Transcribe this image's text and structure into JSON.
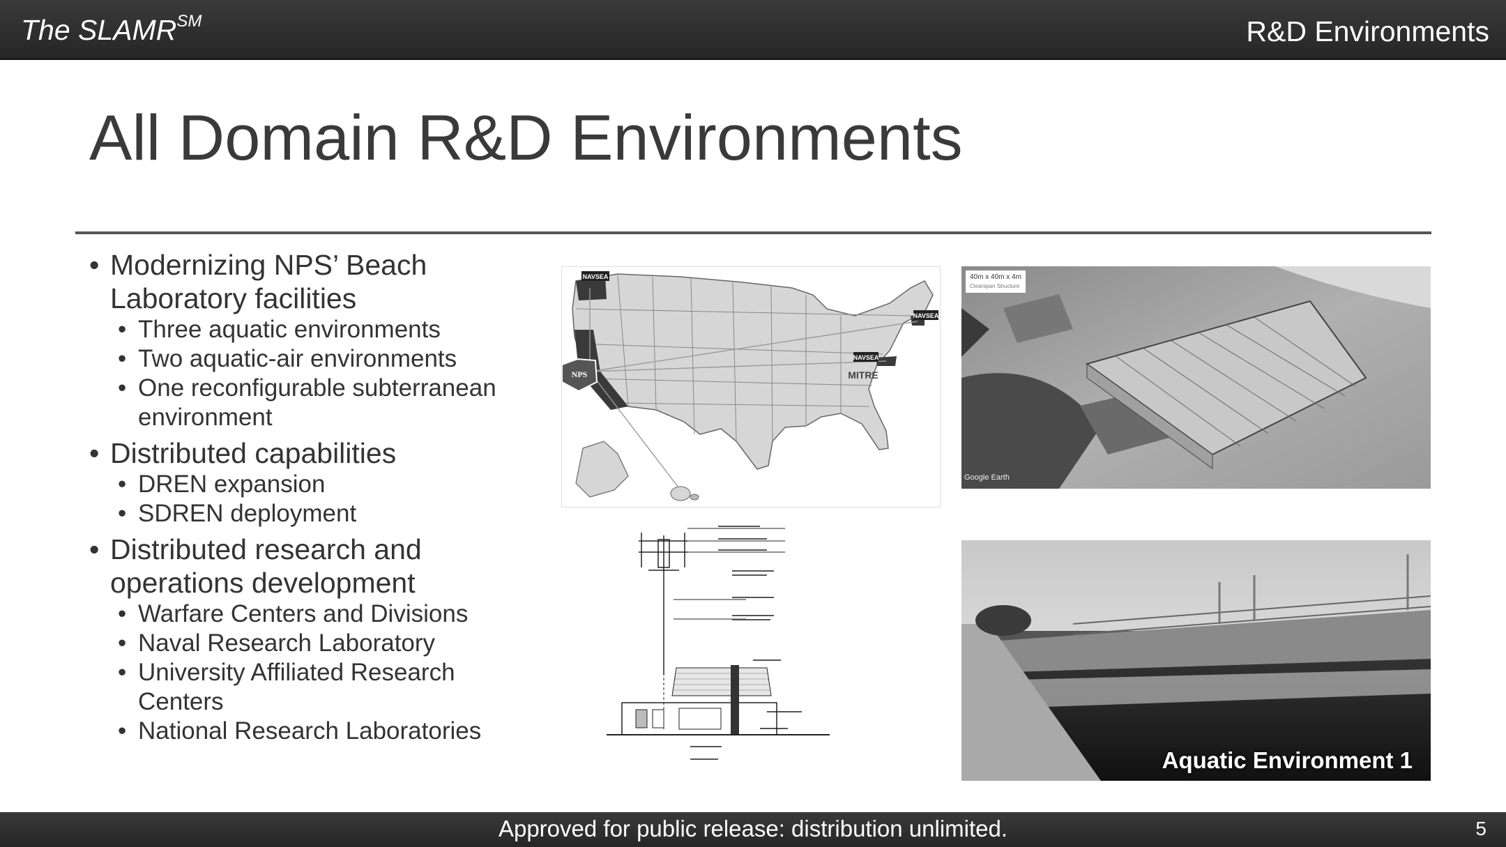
{
  "header": {
    "brand": "The SLAMR",
    "brand_sup": "SM",
    "section": "R&D Environments"
  },
  "slide": {
    "title": "All Domain R&D Environments"
  },
  "bullets": [
    {
      "text": "Modernizing NPS’ Beach Laboratory facilities",
      "sub": [
        "Three aquatic environments",
        "Two aquatic-air environments",
        "One reconfigurable subterranean environment"
      ]
    },
    {
      "text": "Distributed capabilities",
      "sub": [
        "DREN expansion",
        "SDREN deployment"
      ]
    },
    {
      "text": "Distributed research and operations development",
      "sub": [
        "Warfare Centers and Divisions",
        "Naval Research Laboratory",
        "University Affiliated Research Centers",
        "National Research Laboratories"
      ]
    }
  ],
  "map": {
    "labels": [
      "NAVSEA",
      "NAVSEA",
      "NAVSEA",
      "MITRE",
      "NPS"
    ]
  },
  "photos": {
    "earth_tag": "40m x 40m x 4m",
    "earth_tag_sub": "Clearspan Structure",
    "earth_credit": "Google Earth",
    "aquatic_caption": "Aquatic Environment 1"
  },
  "footer": {
    "text": "Approved for public release: distribution unlimited.",
    "page": "5"
  },
  "colors": {
    "bar": "#2e2e2e",
    "title": "#3a3a3a",
    "rule": "#555555"
  }
}
